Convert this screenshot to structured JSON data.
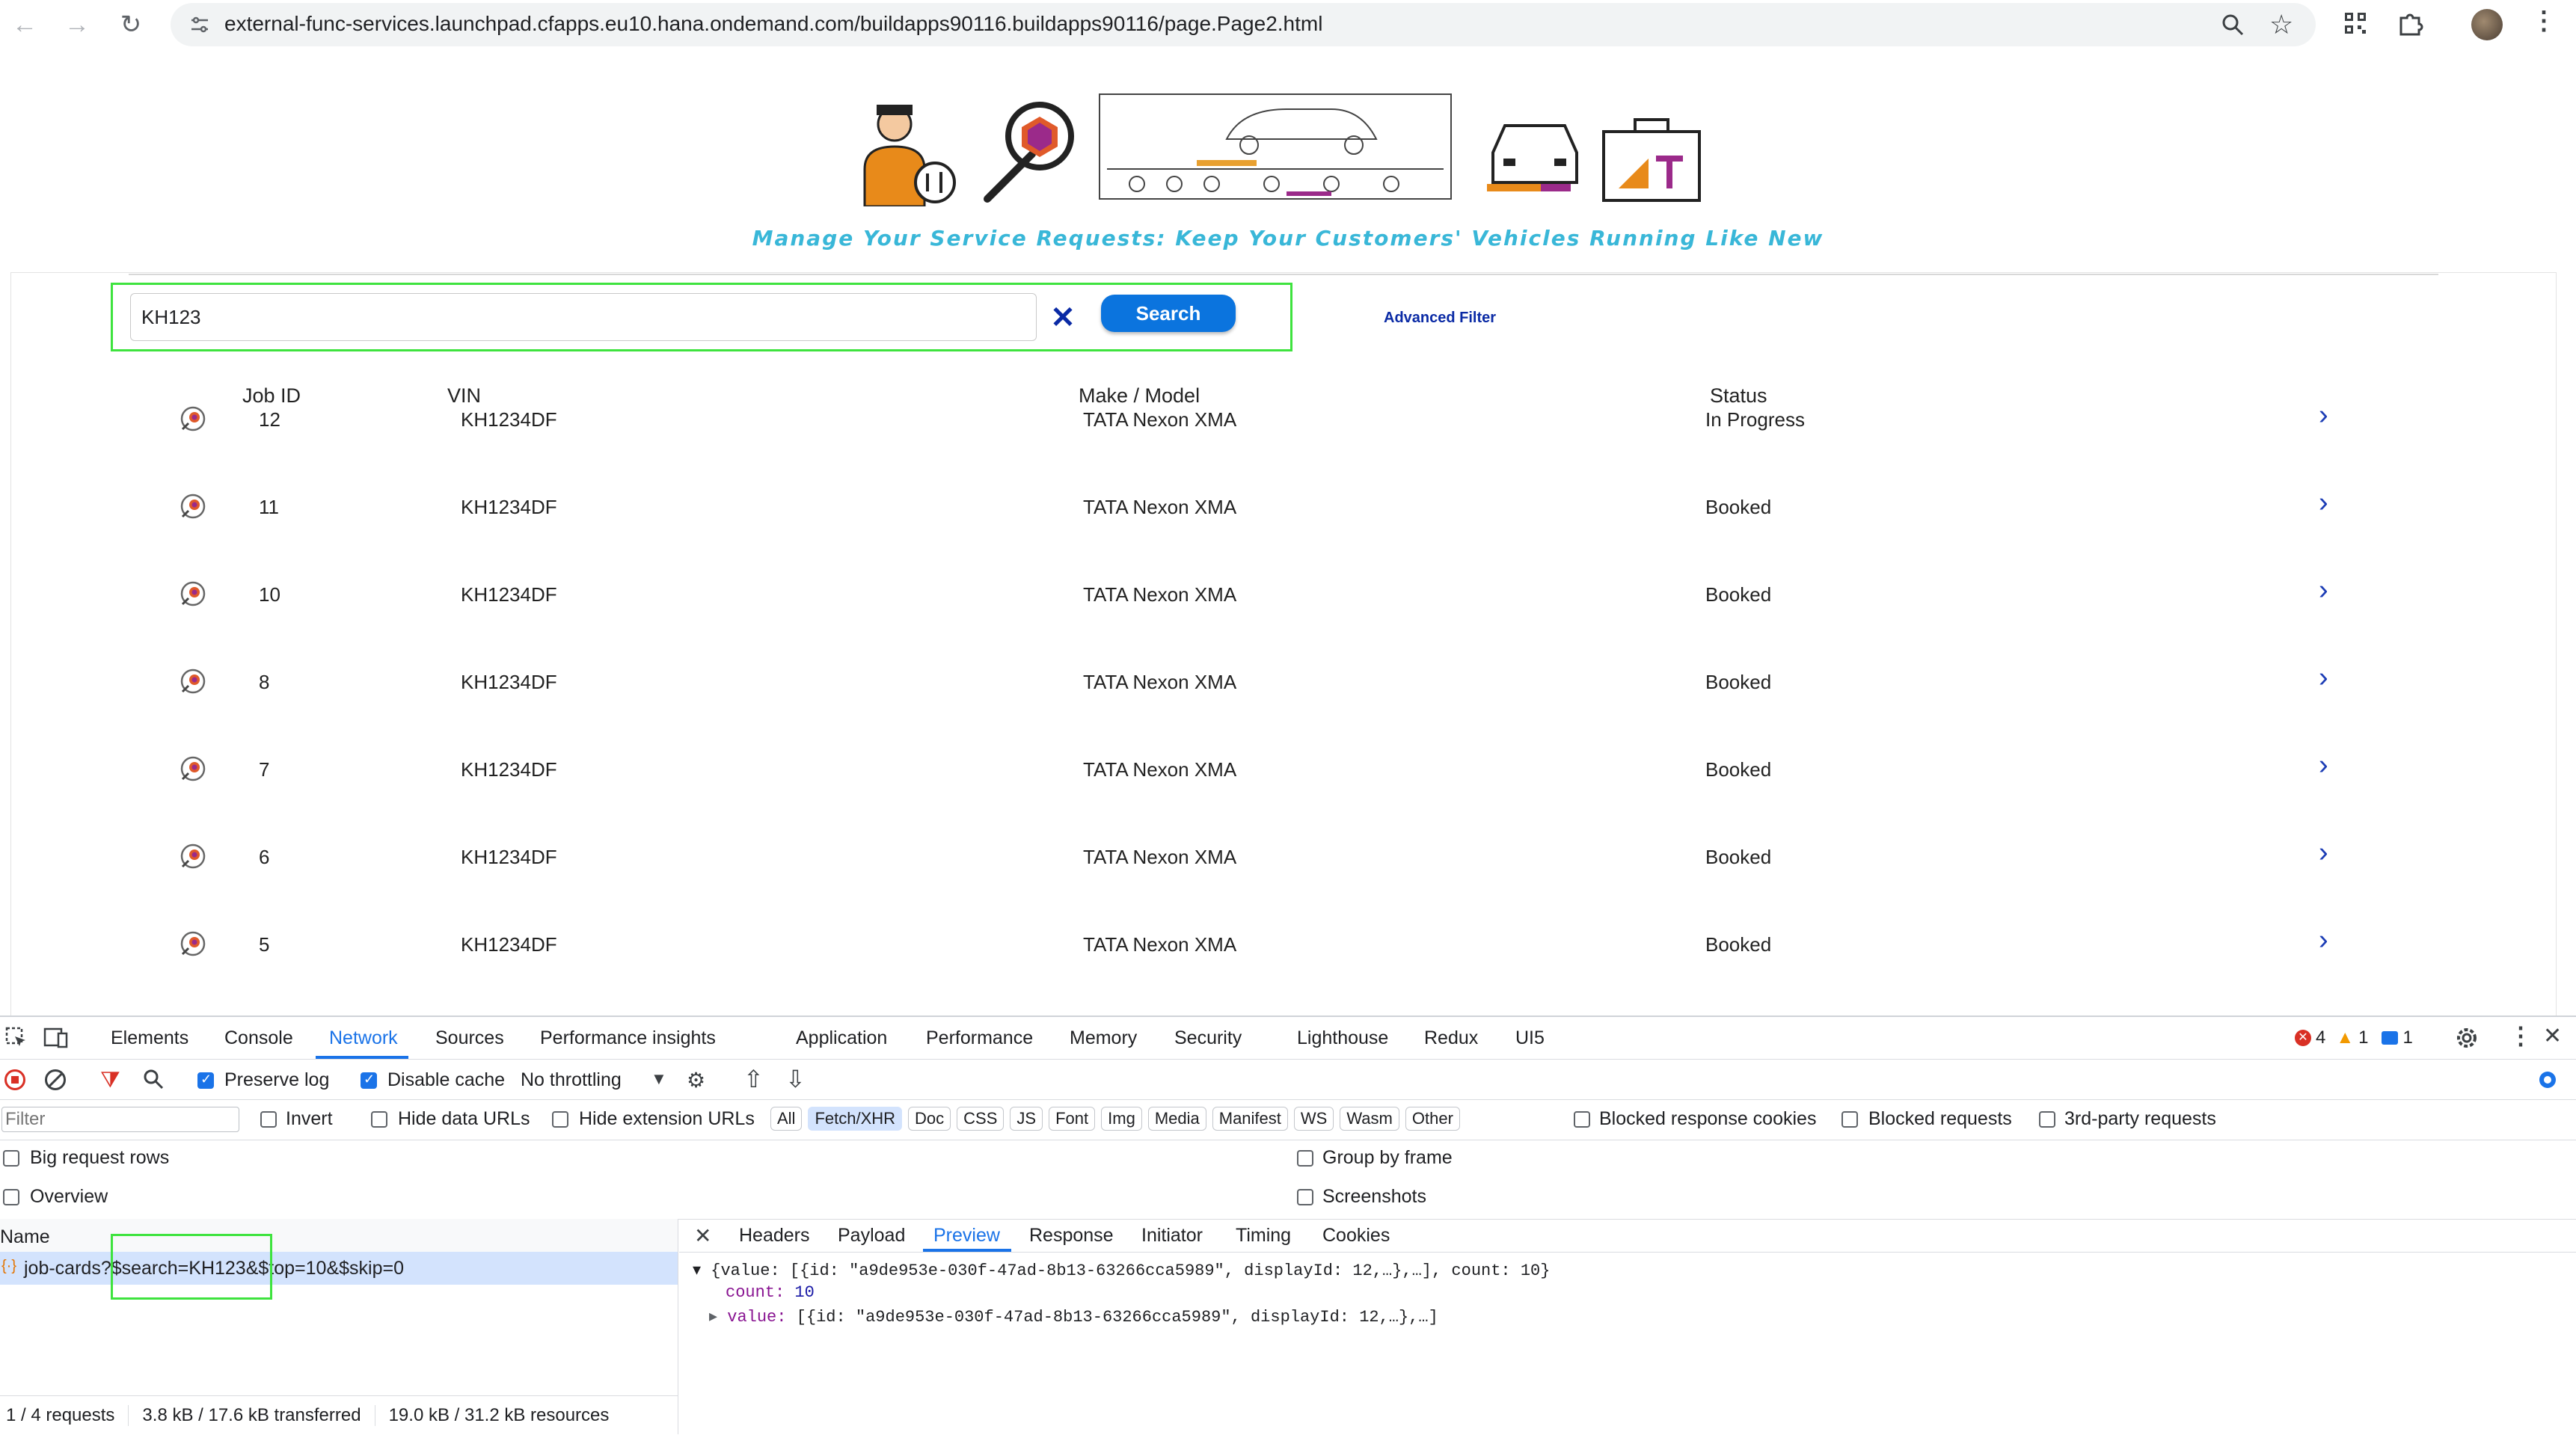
{
  "browser": {
    "url": "external-func-services.launchpad.cfapps.eu10.hana.ondemand.com/buildapps90116.buildapps90116/page.Page2.html"
  },
  "page": {
    "tagline": "Manage Your Service Requests: Keep Your Customers' Vehicles Running Like New",
    "search": {
      "value": "KH123",
      "button": "Search",
      "advanced_filter": "Advanced Filter"
    },
    "table": {
      "headers": [
        "Job ID",
        "VIN",
        "Make / Model",
        "Status"
      ],
      "rows": [
        {
          "job_id": "12",
          "vin": "KH1234DF",
          "model": "TATA Nexon XMA",
          "status": "In Progress"
        },
        {
          "job_id": "11",
          "vin": "KH1234DF",
          "model": "TATA Nexon XMA",
          "status": "Booked"
        },
        {
          "job_id": "10",
          "vin": "KH1234DF",
          "model": "TATA Nexon XMA",
          "status": "Booked"
        },
        {
          "job_id": "8",
          "vin": "KH1234DF",
          "model": "TATA Nexon XMA",
          "status": "Booked"
        },
        {
          "job_id": "7",
          "vin": "KH1234DF",
          "model": "TATA Nexon XMA",
          "status": "Booked"
        },
        {
          "job_id": "6",
          "vin": "KH1234DF",
          "model": "TATA Nexon XMA",
          "status": "Booked"
        },
        {
          "job_id": "5",
          "vin": "KH1234DF",
          "model": "TATA Nexon XMA",
          "status": "Booked"
        }
      ]
    }
  },
  "devtools": {
    "tabs": [
      "Elements",
      "Console",
      "Network",
      "Sources",
      "Performance insights",
      "Application",
      "Performance",
      "Memory",
      "Security",
      "Lighthouse",
      "Redux",
      "UI5"
    ],
    "active_tab": "Network",
    "counts": {
      "errors": "4",
      "warnings": "1",
      "messages": "1"
    },
    "toolbar": {
      "preserve_log": "Preserve log",
      "disable_cache": "Disable cache",
      "throttling": "No throttling"
    },
    "filter": {
      "placeholder": "Filter",
      "invert": "Invert",
      "hide_data_urls": "Hide data URLs",
      "hide_extension_urls": "Hide extension URLs",
      "types": [
        "All",
        "Fetch/XHR",
        "Doc",
        "CSS",
        "JS",
        "Font",
        "Img",
        "Media",
        "Manifest",
        "WS",
        "Wasm",
        "Other"
      ],
      "selected_type": "Fetch/XHR",
      "blocked_cookies": "Blocked response cookies",
      "blocked_requests": "Blocked requests",
      "third_party": "3rd-party requests"
    },
    "options": {
      "big_rows": "Big request rows",
      "group_by_frame": "Group by frame",
      "overview": "Overview",
      "screenshots": "Screenshots"
    },
    "requests": {
      "header": "Name",
      "items": [
        "job-cards?$search=KH123&$top=10&$skip=0"
      ]
    },
    "detail_tabs": [
      "Headers",
      "Payload",
      "Preview",
      "Response",
      "Initiator",
      "Timing",
      "Cookies"
    ],
    "active_detail_tab": "Preview",
    "preview": {
      "line1": "{value: [{id: \"a9de953e-030f-47ad-8b13-63266cca5989\", displayId: 12,…},…], count: 10}",
      "count_key": "count:",
      "count_val": "10",
      "value_key": "value:",
      "value_val": "[{id: \"a9de953e-030f-47ad-8b13-63266cca5989\", displayId: 12,…},…]"
    },
    "status": {
      "requests": "1 / 4 requests",
      "transferred": "3.8 kB / 17.6 kB transferred",
      "resources": "19.0 kB / 31.2 kB resources"
    }
  }
}
